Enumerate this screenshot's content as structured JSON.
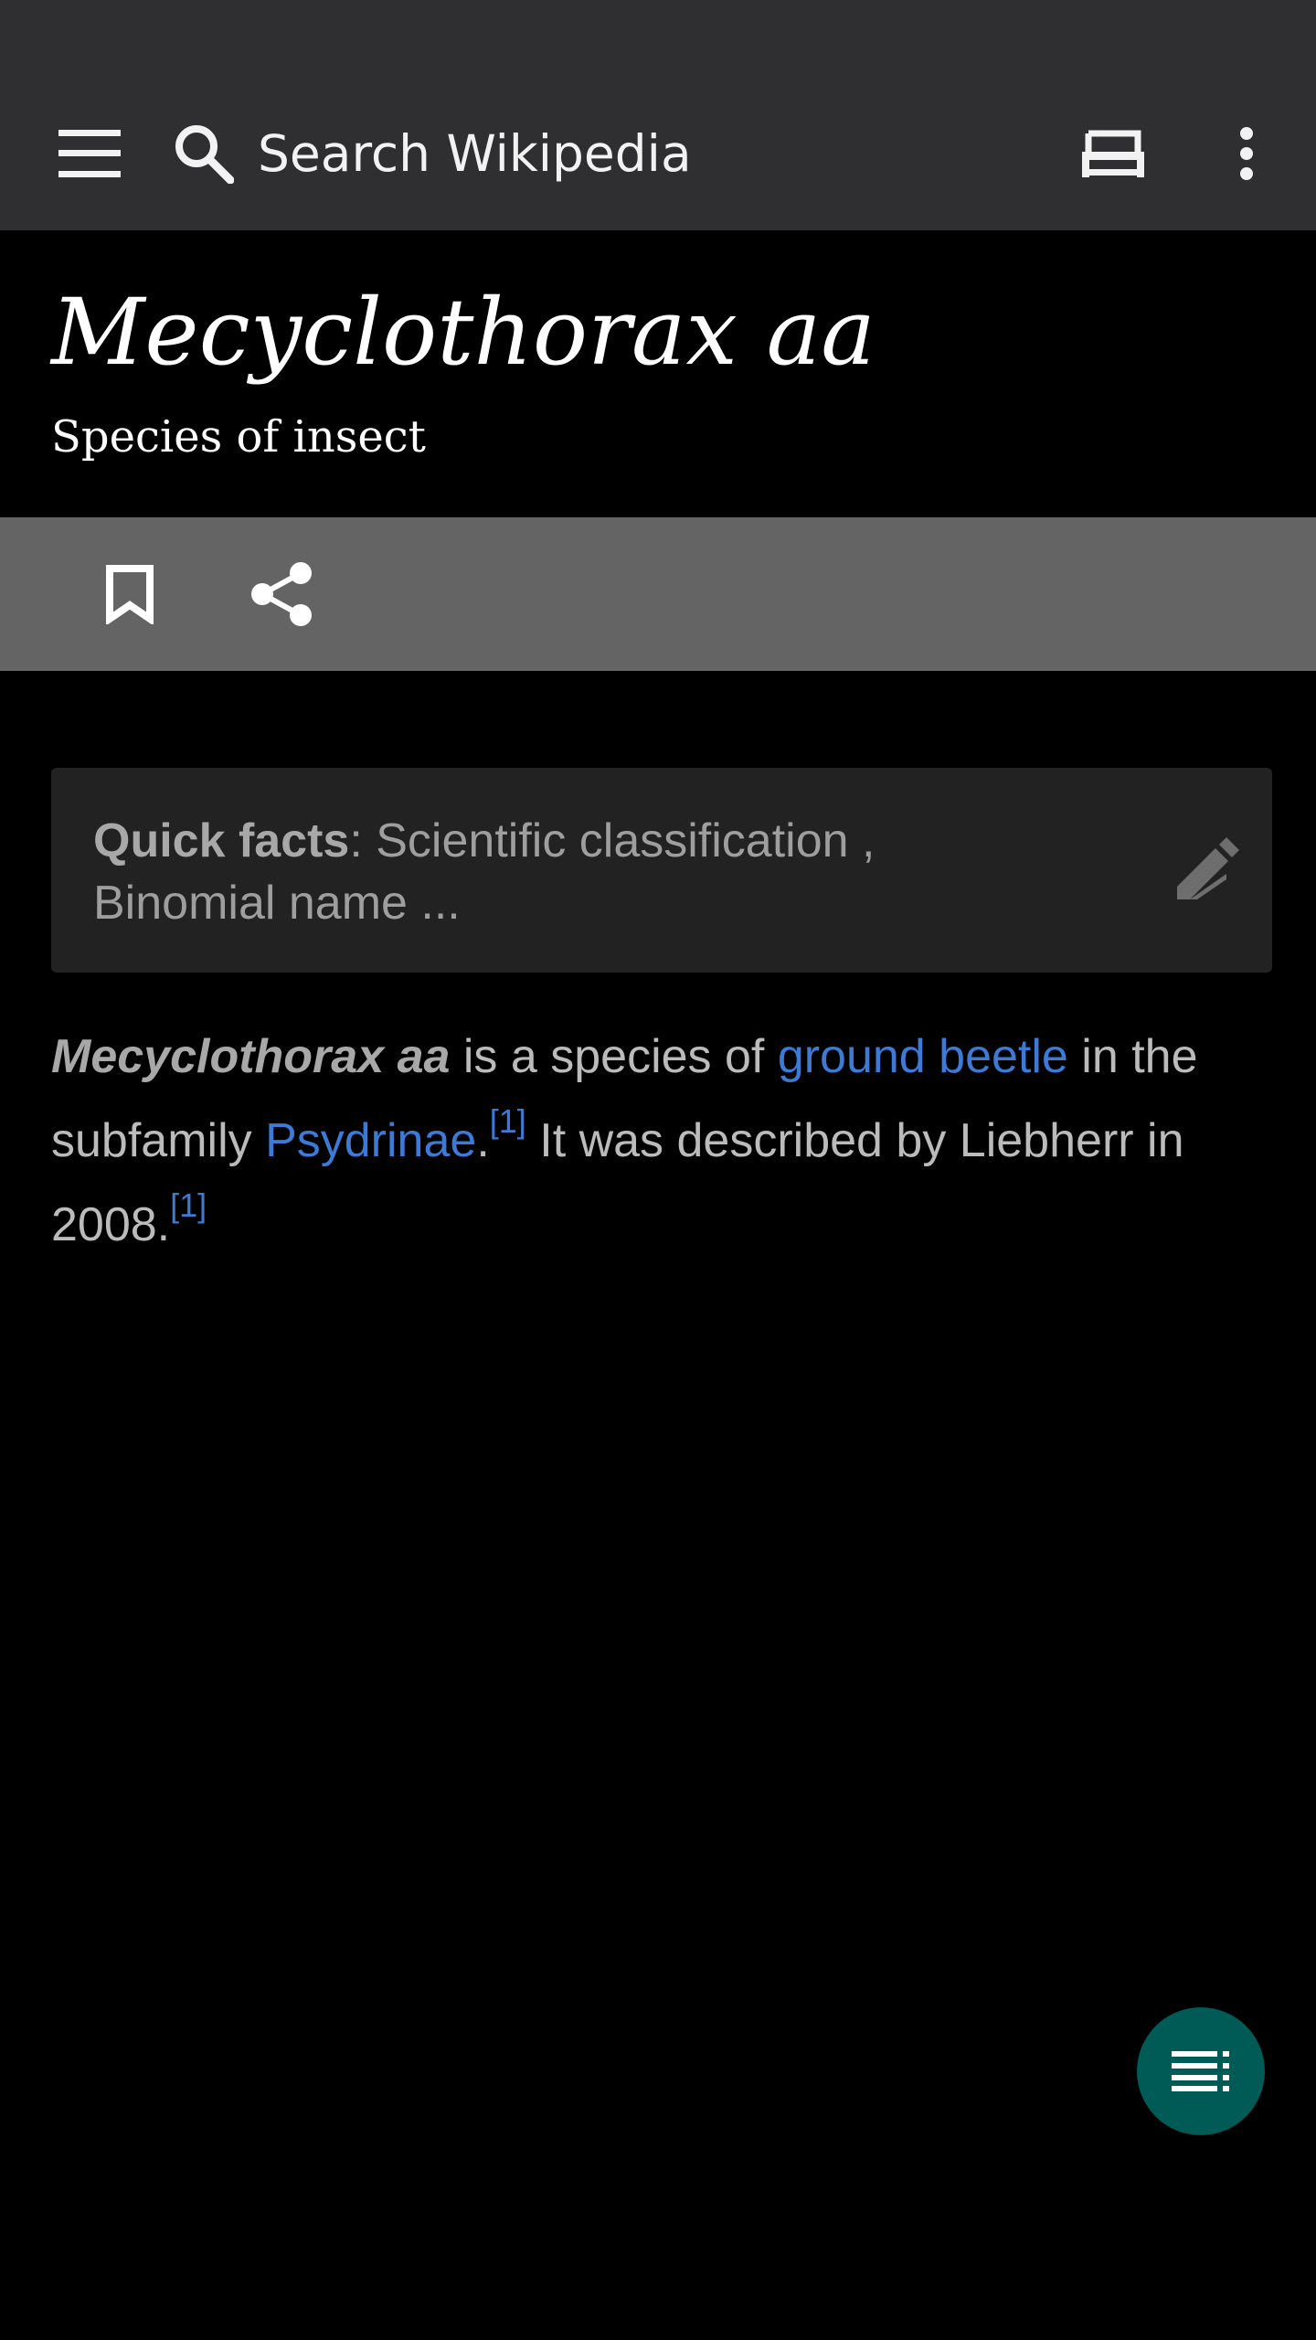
{
  "app_bar": {
    "search_placeholder": "Search Wikipedia",
    "icons": {
      "menu": "menu-icon",
      "search": "search-icon",
      "reading_list": "reading-list-icon",
      "more": "more-vertical-icon"
    }
  },
  "article": {
    "title": "Mecyclothorax aa",
    "subtitle": "Species of insect",
    "quick_facts": {
      "label": "Quick facts",
      "separator": ": ",
      "text": "Scientific classification , Binomial name ..."
    },
    "body": {
      "lead_term": "Mecyclothorax aa",
      "text_1": " is a species of ",
      "link_1": "ground beetle",
      "text_2": " in the subfamily ",
      "link_2": "Psydrinae",
      "text_3": ".",
      "ref_1": "[1]",
      "text_4": " It was described by Liebherr in 2008.",
      "ref_2": "[1]"
    }
  },
  "actions": {
    "icons": {
      "bookmark": "bookmark-icon",
      "share": "share-icon",
      "edit": "edit-pencil-icon",
      "toc": "table-of-contents-icon"
    }
  },
  "colors": {
    "app_bar_bg": "#2f2f31",
    "action_bar_bg": "#646464",
    "link": "#3d7ad6",
    "fab_bg": "#005a55",
    "page_bg": "#000000"
  }
}
